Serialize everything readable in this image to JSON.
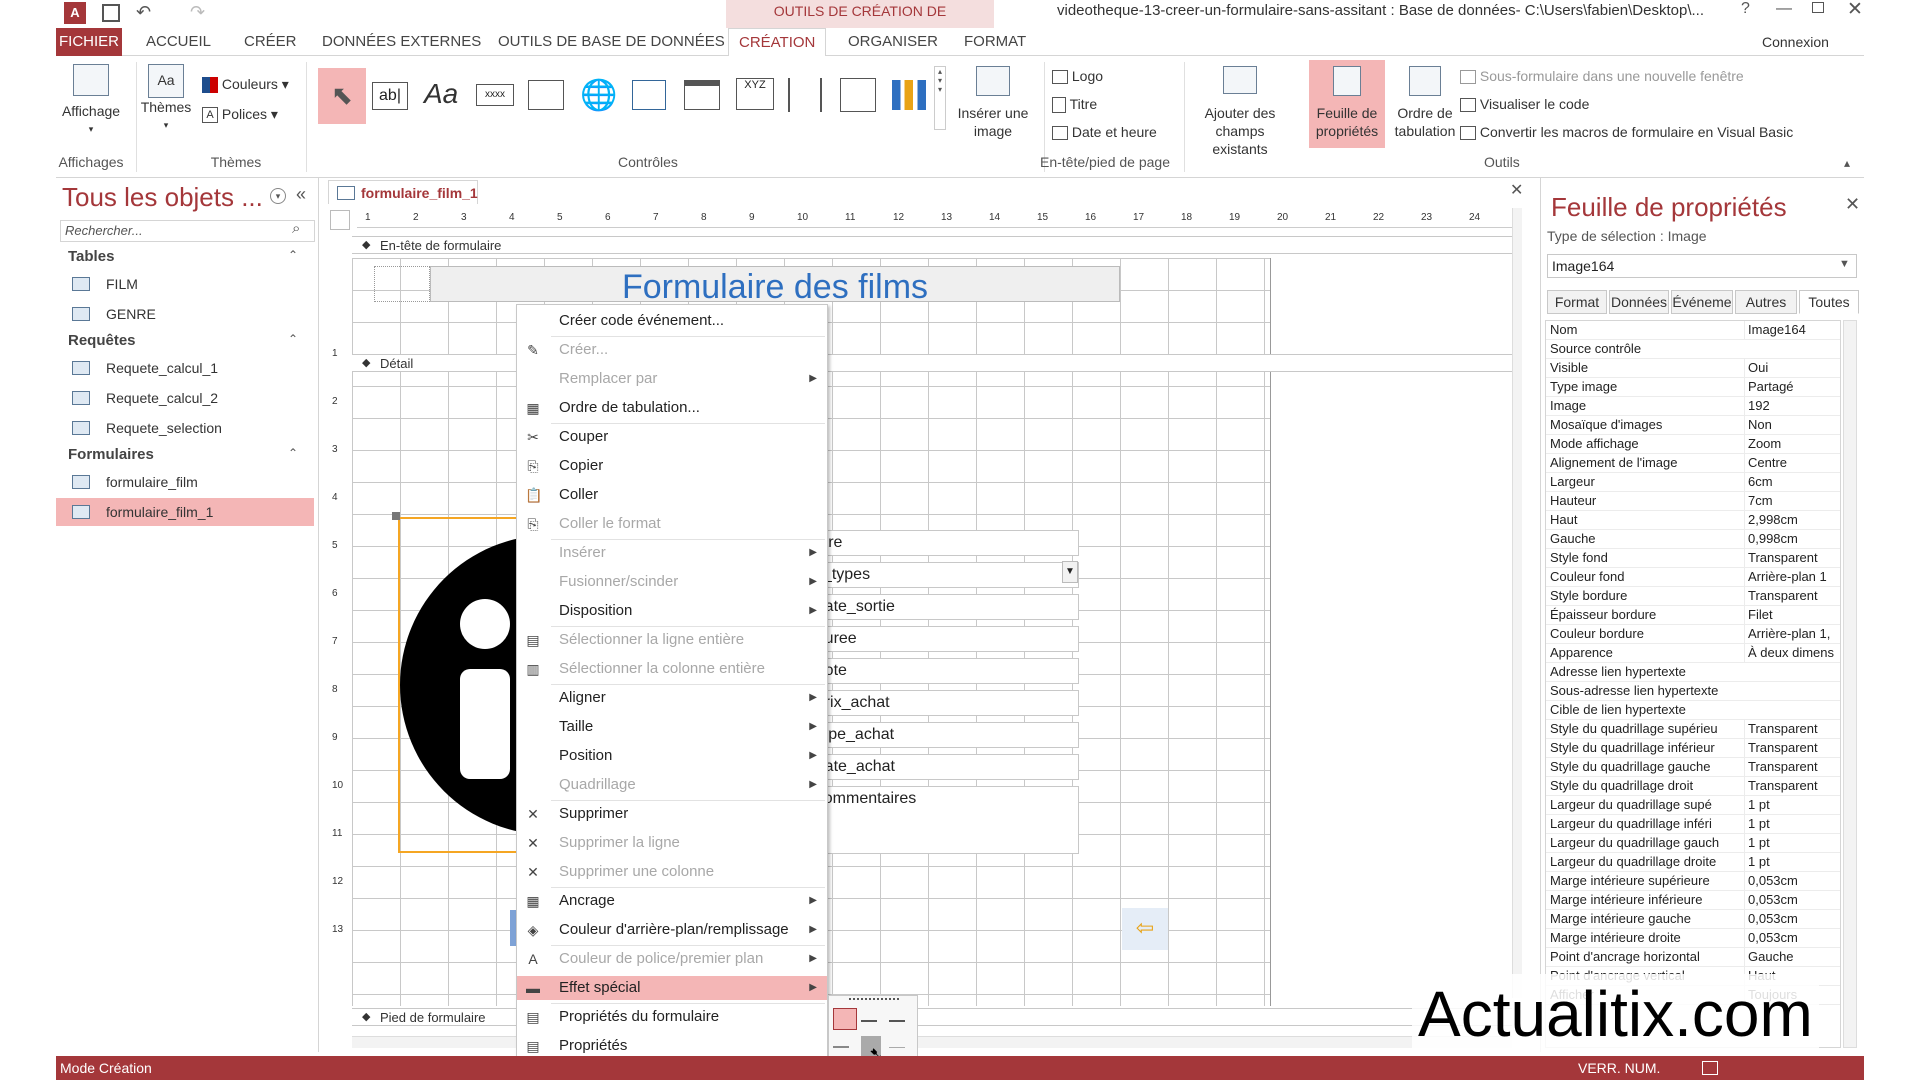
{
  "titlebar": {
    "context_tool": "OUTILS DE CRÉATION DE FORMULAIRE",
    "title": "videotheque-13-creer-un-formulaire-sans-assitant : Base de données- C:\\Users\\fabien\\Desktop\\...",
    "help": "?"
  },
  "tabs": {
    "fichier": "FICHIER",
    "accueil": "ACCUEIL",
    "creer": "CRÉER",
    "donnees": "DONNÉES EXTERNES",
    "outils": "OUTILS DE BASE DE DONNÉES",
    "creation": "CRÉATION",
    "organiser": "ORGANISER",
    "format": "FORMAT",
    "connexion": "Connexion"
  },
  "ribbon": {
    "affichage": "Affichage",
    "affichages": "Affichages",
    "themes": "Thèmes",
    "couleurs": "Couleurs",
    "polices": "Polices",
    "themes_grp": "Thèmes",
    "controles": "Contrôles",
    "inserer_image": "Insérer une image",
    "logo": "Logo",
    "titre": "Titre",
    "date_heure": "Date et heure",
    "entete_pied": "En-tête/pied de page",
    "ajouter_champs": "Ajouter des champs existants",
    "feuille_prop": "Feuille de propriétés",
    "ordre_tab": "Ordre de tabulation",
    "sous_form": "Sous-formulaire dans une nouvelle fenêtre",
    "visualiser_code": "Visualiser le code",
    "convertir": "Convertir les macros de formulaire en Visual Basic",
    "outils": "Outils",
    "ctl_abl": "ab|",
    "ctl_aa": "Aa",
    "ctl_xxxx": "xxxx",
    "ctl_xyz": "XYZ"
  },
  "nav": {
    "title": "Tous les objets ...",
    "search_placeholder": "Rechercher...",
    "tables": "Tables",
    "requetes": "Requêtes",
    "formulaires": "Formulaires",
    "table_items": [
      "FILM",
      "GENRE"
    ],
    "query_items": [
      "Requete_calcul_1",
      "Requete_calcul_2",
      "Requete_selection"
    ],
    "form_items": [
      "formulaire_film",
      "formulaire_film_1"
    ]
  },
  "doc": {
    "tab": "formulaire_film_1",
    "header_section": "En-tête de formulaire",
    "detail_section": "Détail",
    "footer_section": "Pied de formulaire",
    "form_title": "Formulaire des films",
    "ruler_h": [
      "1",
      "2",
      "3",
      "4",
      "5",
      "6",
      "7",
      "8",
      "9",
      "10",
      "11",
      "12",
      "13",
      "14",
      "15",
      "16",
      "17",
      "18",
      "19",
      "20",
      "21",
      "22",
      "23",
      "24"
    ],
    "ruler_v": [
      "1",
      "2",
      "3",
      "4",
      "5",
      "6",
      "7",
      "8",
      "9",
      "10",
      "11",
      "12",
      "13"
    ],
    "fields": [
      "film_titre",
      "genre_types",
      "film_date_sortie",
      "film_duree",
      "film_note",
      "film_prix_achat",
      "film_type_achat",
      "film_date_achat",
      "film_commentaires"
    ],
    "label_stubs": [
      "",
      "",
      "ie",
      "in)",
      "",
      "",
      "",
      "",
      "es"
    ]
  },
  "context_menu": [
    {
      "label": "Créer code événement...",
      "disabled": false,
      "icon": ""
    },
    {
      "label": "Créer...",
      "disabled": true,
      "icon": "✎"
    },
    {
      "label": "Remplacer par",
      "disabled": true,
      "icon": "",
      "submenu": true
    },
    {
      "label": "Ordre de tabulation...",
      "disabled": false,
      "icon": "▦"
    },
    {
      "label": "Couper",
      "disabled": false,
      "icon": "✂"
    },
    {
      "label": "Copier",
      "disabled": false,
      "icon": "⎘"
    },
    {
      "label": "Coller",
      "disabled": false,
      "icon": "📋"
    },
    {
      "label": "Coller le format",
      "disabled": true,
      "icon": "⎘"
    },
    {
      "label": "Insérer",
      "disabled": true,
      "icon": "",
      "submenu": true
    },
    {
      "label": "Fusionner/scinder",
      "disabled": true,
      "icon": "",
      "submenu": true
    },
    {
      "label": "Disposition",
      "disabled": false,
      "icon": "",
      "submenu": true
    },
    {
      "label": "Sélectionner la ligne entière",
      "disabled": true,
      "icon": "▤"
    },
    {
      "label": "Sélectionner la colonne entière",
      "disabled": true,
      "icon": "▥"
    },
    {
      "label": "Aligner",
      "disabled": false,
      "icon": "",
      "submenu": true
    },
    {
      "label": "Taille",
      "disabled": false,
      "icon": "",
      "submenu": true
    },
    {
      "label": "Position",
      "disabled": false,
      "icon": "",
      "submenu": true
    },
    {
      "label": "Quadrillage",
      "disabled": true,
      "icon": "",
      "submenu": true
    },
    {
      "label": "Supprimer",
      "disabled": false,
      "icon": "✕"
    },
    {
      "label": "Supprimer la ligne",
      "disabled": true,
      "icon": "✕"
    },
    {
      "label": "Supprimer une colonne",
      "disabled": true,
      "icon": "✕"
    },
    {
      "label": "Ancrage",
      "disabled": false,
      "icon": "▦",
      "submenu": true
    },
    {
      "label": "Couleur d'arrière-plan/remplissage",
      "disabled": false,
      "icon": "◈",
      "submenu": true
    },
    {
      "label": "Couleur de police/premier plan",
      "disabled": true,
      "icon": "A",
      "submenu": true
    },
    {
      "label": "Effet spécial",
      "disabled": false,
      "icon": "▬",
      "submenu": true,
      "highlight": true
    },
    {
      "label": "Propriétés du formulaire",
      "disabled": false,
      "icon": "▤"
    },
    {
      "label": "Propriétés",
      "disabled": false,
      "icon": "▤"
    }
  ],
  "props": {
    "title": "Feuille de propriétés",
    "sel_type": "Type de sélection :  Image",
    "combo": "Image164",
    "tabs": [
      "Format",
      "Données",
      "Événeme",
      "Autres",
      "Toutes"
    ],
    "rows": [
      [
        "Nom",
        "Image164"
      ],
      [
        "Source contrôle",
        ""
      ],
      [
        "Visible",
        "Oui"
      ],
      [
        "Type image",
        "Partagé"
      ],
      [
        "Image",
        "192"
      ],
      [
        "Mosaïque d'images",
        "Non"
      ],
      [
        "Mode affichage",
        "Zoom"
      ],
      [
        "Alignement de l'image",
        "Centre"
      ],
      [
        "Largeur",
        "6cm"
      ],
      [
        "Hauteur",
        "7cm"
      ],
      [
        "Haut",
        "2,998cm"
      ],
      [
        "Gauche",
        "0,998cm"
      ],
      [
        "Style fond",
        "Transparent"
      ],
      [
        "Couleur fond",
        "Arrière-plan 1"
      ],
      [
        "Style bordure",
        "Transparent"
      ],
      [
        "Épaisseur bordure",
        "Filet"
      ],
      [
        "Couleur bordure",
        "Arrière-plan 1,"
      ],
      [
        "Apparence",
        "À deux dimens"
      ],
      [
        "Adresse lien hypertexte",
        ""
      ],
      [
        "Sous-adresse lien hypertexte",
        ""
      ],
      [
        "Cible de lien hypertexte",
        ""
      ],
      [
        "Style du quadrillage supérieu",
        "Transparent"
      ],
      [
        "Style du quadrillage inférieur",
        "Transparent"
      ],
      [
        "Style du quadrillage gauche",
        "Transparent"
      ],
      [
        "Style du quadrillage droit",
        "Transparent"
      ],
      [
        "Largeur du quadrillage supé",
        "1 pt"
      ],
      [
        "Largeur du quadrillage inféri",
        "1 pt"
      ],
      [
        "Largeur du quadrillage gauch",
        "1 pt"
      ],
      [
        "Largeur du quadrillage droite",
        "1 pt"
      ],
      [
        "Marge intérieure supérieure",
        "0,053cm"
      ],
      [
        "Marge intérieure inférieure",
        "0,053cm"
      ],
      [
        "Marge intérieure gauche",
        "0,053cm"
      ],
      [
        "Marge intérieure droite",
        "0,053cm"
      ],
      [
        "Point d'ancrage horizontal",
        "Gauche"
      ],
      [
        "Point d'ancrage vertical",
        "Haut"
      ],
      [
        "Afficher",
        "Toujours"
      ]
    ]
  },
  "status": {
    "left": "Mode Création",
    "right": "VERR. NUM."
  },
  "watermark": "Actualitix.com",
  "colors": {
    "accent": "#a4373a",
    "highlight": "#f4b6b6",
    "title_blue": "#2e6fc0",
    "selection_orange": "#f5a623"
  }
}
